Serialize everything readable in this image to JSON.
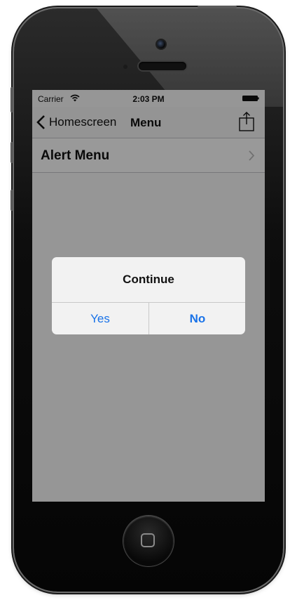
{
  "colors": {
    "accent_blue": "#1a73e8",
    "dim_overlay": "rgba(0,0,0,0.4)",
    "alert_background": "#f2f2f2"
  },
  "statusbar": {
    "carrier": "Carrier",
    "time": "2:03 PM",
    "wifi_icon": "wifi-icon",
    "battery_icon": "battery-icon"
  },
  "navbar": {
    "back_label": "Homescreen",
    "back_icon": "chevron-left-icon",
    "title": "Menu",
    "share_icon": "share-icon"
  },
  "list": {
    "items": [
      {
        "label": "Alert Menu",
        "icon": "chevron-right-icon"
      }
    ]
  },
  "alert": {
    "title": "Continue",
    "buttons": [
      {
        "label": "Yes"
      },
      {
        "label": "No"
      }
    ]
  },
  "device": {
    "home_icon": "home-square-icon"
  }
}
